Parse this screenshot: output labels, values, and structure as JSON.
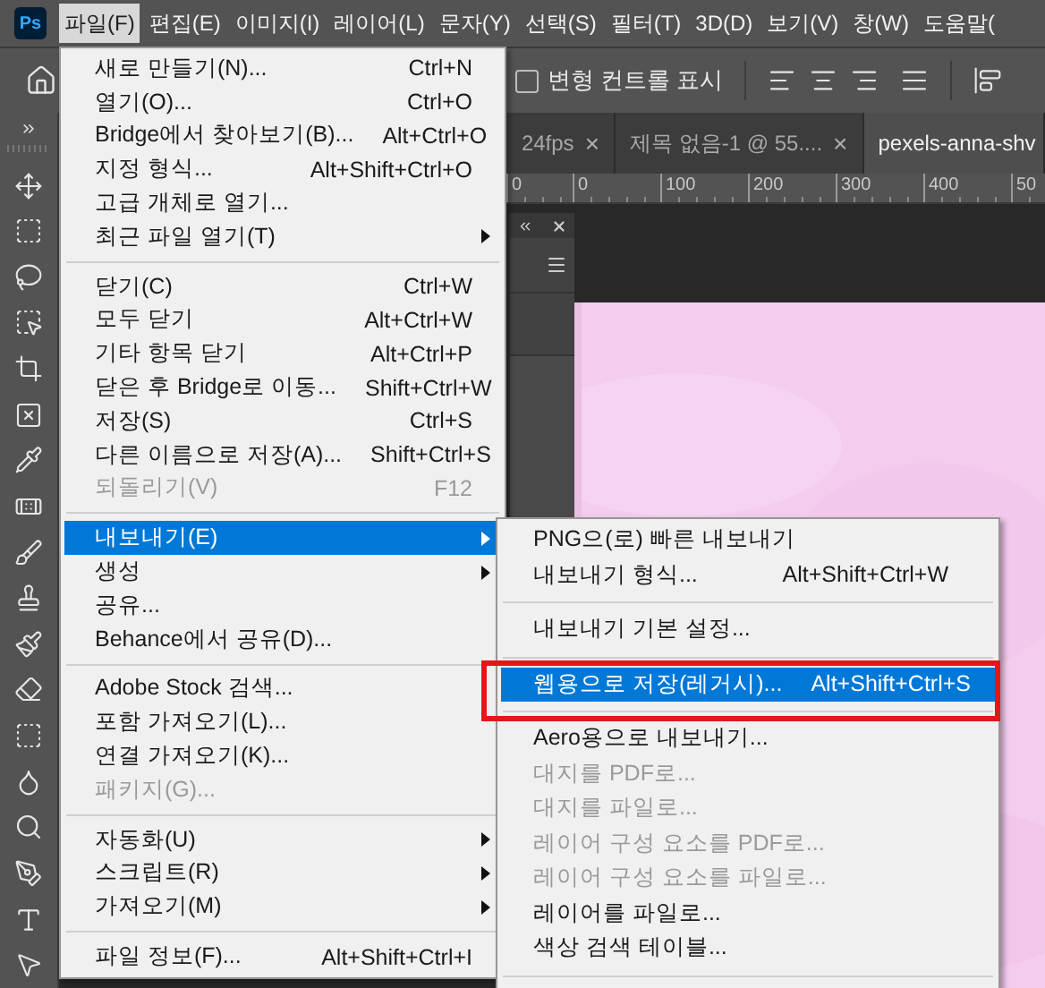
{
  "app": {
    "logo": "Ps"
  },
  "menu_bar": [
    {
      "label": "파일(F)",
      "selected": true
    },
    {
      "label": "편집(E)",
      "selected": false
    },
    {
      "label": "이미지(I)",
      "selected": false
    },
    {
      "label": "레이어(L)",
      "selected": false
    },
    {
      "label": "문자(Y)",
      "selected": false
    },
    {
      "label": "선택(S)",
      "selected": false
    },
    {
      "label": "필터(T)",
      "selected": false
    },
    {
      "label": "3D(D)",
      "selected": false
    },
    {
      "label": "보기(V)",
      "selected": false
    },
    {
      "label": "창(W)",
      "selected": false
    },
    {
      "label": "도움말(",
      "selected": false
    }
  ],
  "options_bar": {
    "checkbox": {
      "label": "변형 컨트롤 표시",
      "checked": false
    }
  },
  "tabs": [
    {
      "label": "24fps",
      "close": "×",
      "selected": false
    },
    {
      "label": "제목 없음-1 @ 55....",
      "close": "×",
      "selected": false
    },
    {
      "label": "pexels-anna-shv",
      "selected": true
    }
  ],
  "ruler": [
    "0",
    "0",
    "100",
    "200",
    "300",
    "400",
    "50"
  ],
  "file_menu": {
    "items": [
      {
        "kind": "item",
        "label": "새로 만들기(N)...",
        "shortcut": "Ctrl+N",
        "disabled": false,
        "selected": false,
        "has_submenu": false
      },
      {
        "kind": "item",
        "label": "열기(O)...",
        "shortcut": "Ctrl+O",
        "disabled": false,
        "selected": false,
        "has_submenu": false
      },
      {
        "kind": "item",
        "label": "Bridge에서 찾아보기(B)...",
        "shortcut": "Alt+Ctrl+O",
        "disabled": false,
        "selected": false,
        "has_submenu": false
      },
      {
        "kind": "item",
        "label": "지정 형식...",
        "shortcut": "Alt+Shift+Ctrl+O",
        "disabled": false,
        "selected": false,
        "has_submenu": false
      },
      {
        "kind": "item",
        "label": "고급 개체로 열기...",
        "disabled": false,
        "selected": false,
        "has_submenu": false
      },
      {
        "kind": "item",
        "label": "최근 파일 열기(T)",
        "disabled": false,
        "selected": false,
        "has_submenu": true
      },
      {
        "kind": "separator"
      },
      {
        "kind": "item",
        "label": "닫기(C)",
        "shortcut": "Ctrl+W",
        "disabled": false,
        "selected": false,
        "has_submenu": false
      },
      {
        "kind": "item",
        "label": "모두 닫기",
        "shortcut": "Alt+Ctrl+W",
        "disabled": false,
        "selected": false,
        "has_submenu": false
      },
      {
        "kind": "item",
        "label": "기타 항목 닫기",
        "shortcut": "Alt+Ctrl+P",
        "disabled": false,
        "selected": false,
        "has_submenu": false
      },
      {
        "kind": "item",
        "label": "닫은 후 Bridge로 이동...",
        "shortcut": "Shift+Ctrl+W",
        "disabled": false,
        "selected": false,
        "has_submenu": false
      },
      {
        "kind": "item",
        "label": "저장(S)",
        "shortcut": "Ctrl+S",
        "disabled": false,
        "selected": false,
        "has_submenu": false
      },
      {
        "kind": "item",
        "label": "다른 이름으로 저장(A)...",
        "shortcut": "Shift+Ctrl+S",
        "disabled": false,
        "selected": false,
        "has_submenu": false
      },
      {
        "kind": "item",
        "label": "되돌리기(V)",
        "shortcut": "F12",
        "disabled": true,
        "selected": false,
        "has_submenu": false
      },
      {
        "kind": "separator"
      },
      {
        "kind": "item",
        "label": "내보내기(E)",
        "disabled": false,
        "selected": true,
        "has_submenu": true
      },
      {
        "kind": "item",
        "label": "생성",
        "disabled": false,
        "selected": false,
        "has_submenu": true
      },
      {
        "kind": "item",
        "label": "공유...",
        "disabled": false,
        "selected": false,
        "has_submenu": false
      },
      {
        "kind": "item",
        "label": "Behance에서 공유(D)...",
        "disabled": false,
        "selected": false,
        "has_submenu": false
      },
      {
        "kind": "separator"
      },
      {
        "kind": "item",
        "label": "Adobe Stock 검색...",
        "disabled": false,
        "selected": false,
        "has_submenu": false
      },
      {
        "kind": "item",
        "label": "포함 가져오기(L)...",
        "disabled": false,
        "selected": false,
        "has_submenu": false
      },
      {
        "kind": "item",
        "label": "연결 가져오기(K)...",
        "disabled": false,
        "selected": false,
        "has_submenu": false
      },
      {
        "kind": "item",
        "label": "패키지(G)...",
        "disabled": true,
        "selected": false,
        "has_submenu": false
      },
      {
        "kind": "separator"
      },
      {
        "kind": "item",
        "label": "자동화(U)",
        "disabled": false,
        "selected": false,
        "has_submenu": true
      },
      {
        "kind": "item",
        "label": "스크립트(R)",
        "disabled": false,
        "selected": false,
        "has_submenu": true
      },
      {
        "kind": "item",
        "label": "가져오기(M)",
        "disabled": false,
        "selected": false,
        "has_submenu": true
      },
      {
        "kind": "separator"
      },
      {
        "kind": "item",
        "label": "파일 정보(F)...",
        "shortcut": "Alt+Shift+Ctrl+I",
        "disabled": false,
        "selected": false,
        "has_submenu": false
      }
    ]
  },
  "export_submenu": {
    "items": [
      {
        "kind": "item",
        "label": "PNG으(로) 빠른 내보내기",
        "disabled": false,
        "selected": false
      },
      {
        "kind": "item",
        "label": "내보내기 형식...",
        "shortcut": "Alt+Shift+Ctrl+W",
        "disabled": false,
        "selected": false
      },
      {
        "kind": "separator"
      },
      {
        "kind": "item",
        "label": "내보내기 기본 설정...",
        "disabled": false,
        "selected": false
      },
      {
        "kind": "separator"
      },
      {
        "kind": "item",
        "label": "웹용으로 저장(레거시)...",
        "shortcut": "Alt+Shift+Ctrl+S",
        "disabled": false,
        "selected": true
      },
      {
        "kind": "separator"
      },
      {
        "kind": "item",
        "label": "Aero용으로 내보내기...",
        "disabled": false,
        "selected": false
      },
      {
        "kind": "item",
        "label": "대지를 PDF로...",
        "disabled": true,
        "selected": false
      },
      {
        "kind": "item",
        "label": "대지를 파일로...",
        "disabled": true,
        "selected": false
      },
      {
        "kind": "item",
        "label": "레이어 구성 요소를 PDF로...",
        "disabled": true,
        "selected": false
      },
      {
        "kind": "item",
        "label": "레이어 구성 요소를 파일로...",
        "disabled": true,
        "selected": false
      },
      {
        "kind": "item",
        "label": "레이어를 파일로...",
        "disabled": false,
        "selected": false
      },
      {
        "kind": "item",
        "label": "색상 검색 테이블...",
        "disabled": false,
        "selected": false
      },
      {
        "kind": "separator"
      }
    ]
  }
}
